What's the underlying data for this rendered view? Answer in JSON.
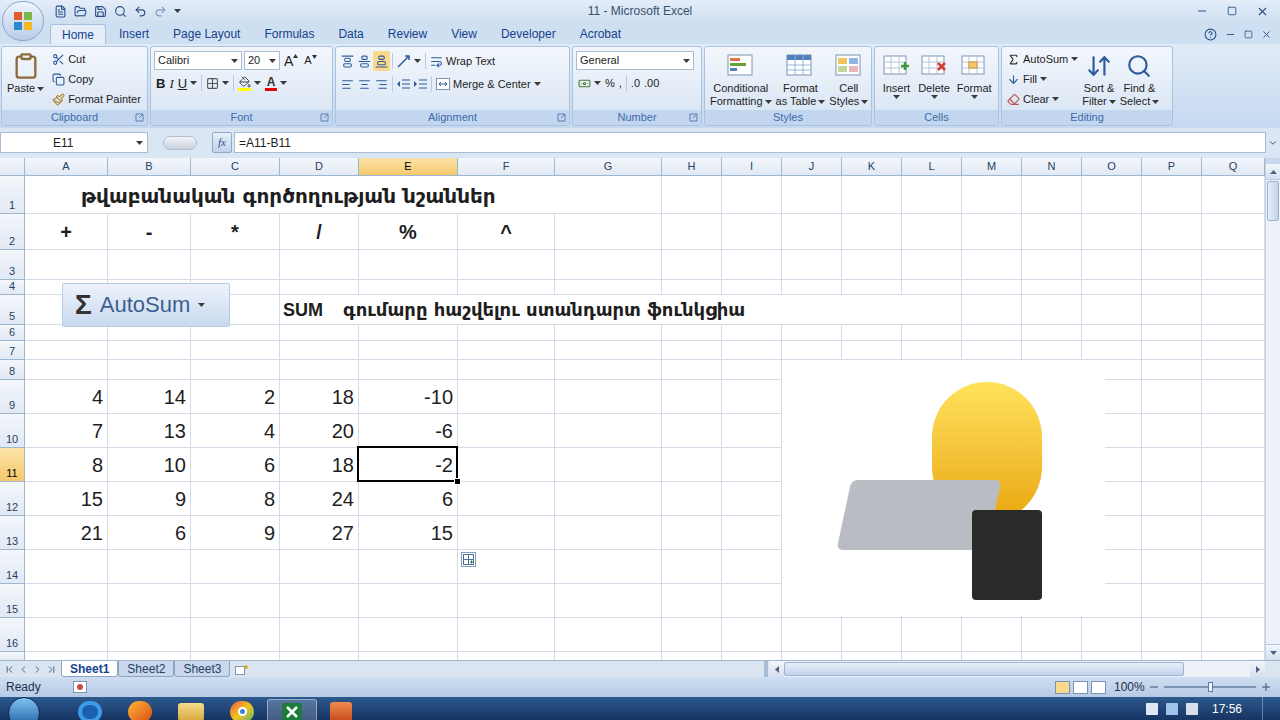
{
  "window": {
    "title": "11 - Microsoft Excel"
  },
  "ribbon_tabs": [
    {
      "label": "Home",
      "selected": true
    },
    {
      "label": "Insert",
      "selected": false
    },
    {
      "label": "Page Layout",
      "selected": false
    },
    {
      "label": "Formulas",
      "selected": false
    },
    {
      "label": "Data",
      "selected": false
    },
    {
      "label": "Review",
      "selected": false
    },
    {
      "label": "View",
      "selected": false
    },
    {
      "label": "Developer",
      "selected": false
    },
    {
      "label": "Acrobat",
      "selected": false
    }
  ],
  "clipboard": {
    "label": "Clipboard",
    "paste": "Paste",
    "cut": "Cut",
    "copy": "Copy",
    "format_painter": "Format Painter"
  },
  "font": {
    "label": "Font",
    "name": "Calibri",
    "size": "20",
    "grow": "A",
    "shrink": "A",
    "bold": "B",
    "italic": "I",
    "underline": "U",
    "font_color": "A"
  },
  "alignment": {
    "label": "Alignment",
    "wrap_text": "Wrap Text",
    "merge_center": "Merge & Center"
  },
  "number": {
    "label": "Number",
    "format": "General",
    "percent": "%",
    "comma": ",",
    "increase_decimal": ".0",
    "decrease_decimal": ".00"
  },
  "styles": {
    "label": "Styles",
    "buttons": [
      [
        "Conditional",
        "Formatting"
      ],
      [
        "Format",
        "as Table"
      ],
      [
        "Cell",
        "Styles"
      ]
    ]
  },
  "cells": {
    "label": "Cells",
    "buttons": [
      "Insert",
      "Delete",
      "Format"
    ]
  },
  "editing": {
    "label": "Editing",
    "small_buttons": [
      "AutoSum",
      "Fill",
      "Clear"
    ],
    "large_buttons": [
      [
        "Sort &",
        "Filter"
      ],
      [
        "Find &",
        "Select"
      ]
    ]
  },
  "formula_bar": {
    "name_box": "E11",
    "function_button": "fx",
    "formula": "=A11-B11"
  },
  "sheet": {
    "columns": [
      {
        "label": "A",
        "selected": false
      },
      {
        "label": "B",
        "selected": false
      },
      {
        "label": "C",
        "selected": false
      },
      {
        "label": "D",
        "selected": false
      },
      {
        "label": "E",
        "selected": true
      },
      {
        "label": "F",
        "selected": false
      },
      {
        "label": "G",
        "selected": false
      },
      {
        "label": "H",
        "selected": false
      },
      {
        "label": "I",
        "selected": false
      },
      {
        "label": "J",
        "selected": false
      },
      {
        "label": "K",
        "selected": false
      },
      {
        "label": "L",
        "selected": false
      },
      {
        "label": "M",
        "selected": false
      },
      {
        "label": "N",
        "selected": false
      },
      {
        "label": "O",
        "selected": false
      },
      {
        "label": "P",
        "selected": false
      },
      {
        "label": "Q",
        "selected": false
      }
    ],
    "rows": [
      {
        "label": "1",
        "selected": false
      },
      {
        "label": "2",
        "selected": false
      },
      {
        "label": "3",
        "selected": false
      },
      {
        "label": "4",
        "selected": false
      },
      {
        "label": "5",
        "selected": false
      },
      {
        "label": "6",
        "selected": false
      },
      {
        "label": "7",
        "selected": false
      },
      {
        "label": "8",
        "selected": false
      },
      {
        "label": "9",
        "selected": false
      },
      {
        "label": "10",
        "selected": false
      },
      {
        "label": "11",
        "selected": true
      },
      {
        "label": "12",
        "selected": false
      },
      {
        "label": "13",
        "selected": false
      },
      {
        "label": "14",
        "selected": false
      },
      {
        "label": "15",
        "selected": false
      },
      {
        "label": "16",
        "selected": false
      }
    ],
    "heading": "թվաբանական գործողության նշաններ",
    "operators": [
      "+",
      "-",
      "*",
      "/",
      "%",
      "^"
    ],
    "sum_name": "SUM",
    "sum_description": "գումարը հաշվելու ստանդարտ ֆունկցիա",
    "autosum_picture": {
      "symbol": "Σ",
      "label": "AutoSum"
    },
    "values": [
      [
        {
          "text": "4",
          "selected": false
        },
        {
          "text": "14",
          "selected": false
        },
        {
          "text": "2",
          "selected": false
        },
        {
          "text": "18",
          "selected": false
        },
        {
          "text": "-10",
          "selected": false
        }
      ],
      [
        {
          "text": "7",
          "selected": false
        },
        {
          "text": "13",
          "selected": false
        },
        {
          "text": "4",
          "selected": false
        },
        {
          "text": "20",
          "selected": false
        },
        {
          "text": "-6",
          "selected": false
        }
      ],
      [
        {
          "text": "8",
          "selected": false
        },
        {
          "text": "10",
          "selected": false
        },
        {
          "text": "6",
          "selected": false
        },
        {
          "text": "18",
          "selected": false
        },
        {
          "text": "-2",
          "selected": true
        }
      ],
      [
        {
          "text": "15",
          "selected": false
        },
        {
          "text": "9",
          "selected": false
        },
        {
          "text": "8",
          "selected": false
        },
        {
          "text": "24",
          "selected": false
        },
        {
          "text": "6",
          "selected": false
        }
      ],
      [
        {
          "text": "21",
          "selected": false
        },
        {
          "text": "6",
          "selected": false
        },
        {
          "text": "9",
          "selected": false
        },
        {
          "text": "27",
          "selected": false
        },
        {
          "text": "15",
          "selected": false
        }
      ]
    ]
  },
  "sheet_tabs": [
    {
      "label": "Sheet1",
      "selected": true
    },
    {
      "label": "Sheet2",
      "selected": false
    },
    {
      "label": "Sheet3",
      "selected": false
    }
  ],
  "status_bar": {
    "status": "Ready",
    "zoom": "100%",
    "zoom_level": 0.5
  },
  "taskbar": {
    "time": "17:56"
  }
}
